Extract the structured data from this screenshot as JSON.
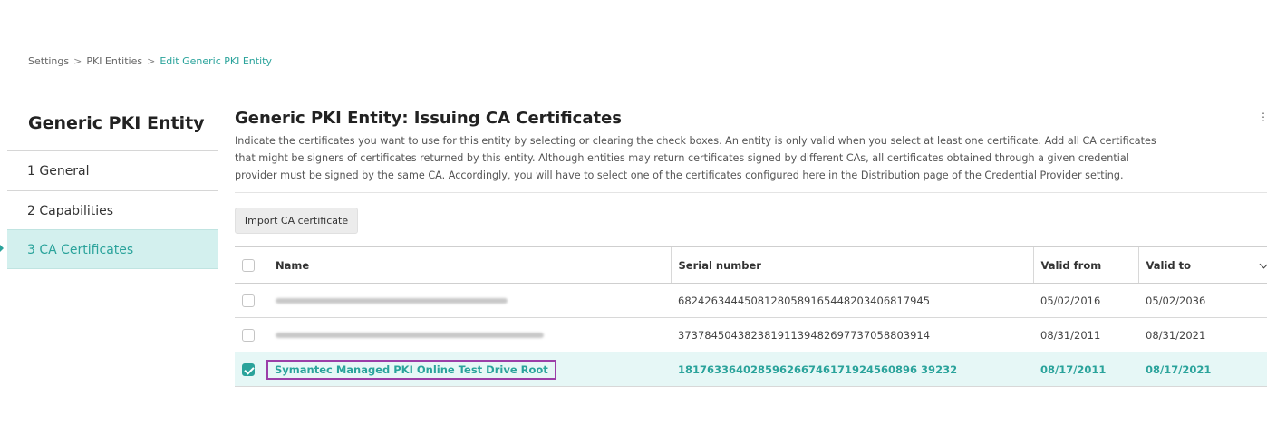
{
  "breadcrumb": {
    "items": [
      "Settings",
      "PKI Entities"
    ],
    "separator": ">",
    "current": "Edit Generic PKI Entity"
  },
  "sidebar": {
    "title": "Generic PKI Entity",
    "items": [
      {
        "label": "1  General"
      },
      {
        "label": "2  Capabilities"
      },
      {
        "label": "3  CA Certificates",
        "active": true
      }
    ]
  },
  "main": {
    "title": "Generic PKI Entity: Issuing CA Certificates",
    "description": "Indicate the certificates you want to use for this entity by selecting or clearing the check boxes. An entity is only valid when you select at least one certificate. Add all CA certificates that might be signers of certificates returned by this entity. Although entities may return certificates signed by different CAs, all certificates obtained through a given credential provider must be signed by the same CA. Accordingly, you will have to select one of the certificates configured here in the Distribution page of the Credential Provider setting.",
    "import_button": "Import CA certificate",
    "kebab_icon": "more-vertical-icon"
  },
  "table": {
    "columns": [
      "Name",
      "Serial number",
      "Valid from",
      "Valid to"
    ],
    "rows": [
      {
        "name": "",
        "redacted": true,
        "serial": "68242634445081280589165448203406817945",
        "valid_from": "05/02/2016",
        "valid_to": "05/02/2036",
        "checked": false
      },
      {
        "name": "",
        "redacted": true,
        "serial": "37378450438238191139482697737058803914",
        "valid_from": "08/31/2011",
        "valid_to": "08/31/2021",
        "checked": false
      },
      {
        "name": "Symantec Managed PKI Online Test Drive Root",
        "redacted": false,
        "serial": "181763364028596266746171924560896 39232",
        "valid_from": "08/17/2011",
        "valid_to": "08/17/2021",
        "checked": true
      }
    ]
  },
  "colors": {
    "accent": "#2aa39b",
    "active_bg": "#d3f0ee",
    "highlight_border": "#9b3fa8"
  }
}
